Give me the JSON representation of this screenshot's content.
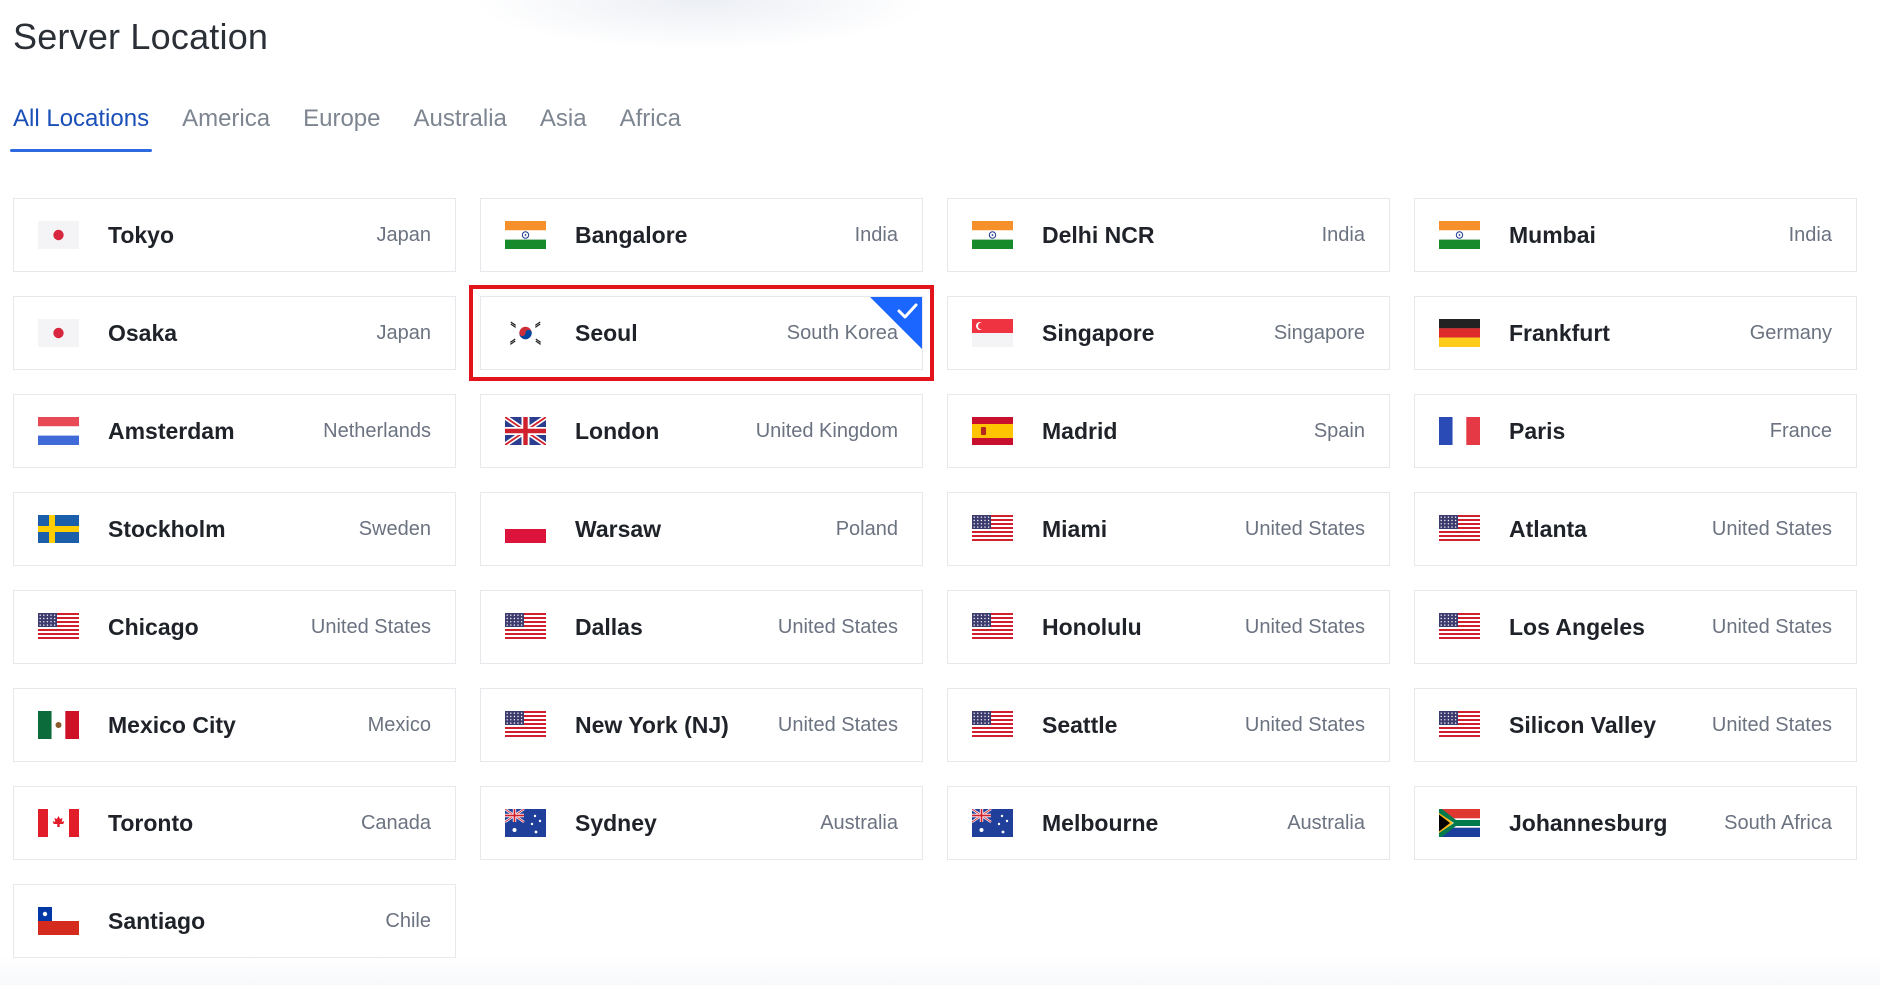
{
  "page": {
    "title": "Server Location"
  },
  "tabs": [
    {
      "label": "All Locations",
      "active": true
    },
    {
      "label": "America",
      "active": false
    },
    {
      "label": "Europe",
      "active": false
    },
    {
      "label": "Australia",
      "active": false
    },
    {
      "label": "Asia",
      "active": false
    },
    {
      "label": "Africa",
      "active": false
    }
  ],
  "selected_location": "Seoul",
  "colors": {
    "accent": "#2d6ae0",
    "selection_outline": "#e3131b",
    "check_badge": "#1a66ff"
  },
  "locations": [
    {
      "city": "Tokyo",
      "country": "Japan",
      "flag": "jp-flag-icon"
    },
    {
      "city": "Bangalore",
      "country": "India",
      "flag": "in-flag-icon"
    },
    {
      "city": "Delhi NCR",
      "country": "India",
      "flag": "in-flag-icon"
    },
    {
      "city": "Mumbai",
      "country": "India",
      "flag": "in-flag-icon"
    },
    {
      "city": "Osaka",
      "country": "Japan",
      "flag": "jp-flag-icon"
    },
    {
      "city": "Seoul",
      "country": "South Korea",
      "flag": "kr-flag-icon"
    },
    {
      "city": "Singapore",
      "country": "Singapore",
      "flag": "sg-flag-icon"
    },
    {
      "city": "Frankfurt",
      "country": "Germany",
      "flag": "de-flag-icon"
    },
    {
      "city": "Amsterdam",
      "country": "Netherlands",
      "flag": "nl-flag-icon"
    },
    {
      "city": "London",
      "country": "United Kingdom",
      "flag": "gb-flag-icon"
    },
    {
      "city": "Madrid",
      "country": "Spain",
      "flag": "es-flag-icon"
    },
    {
      "city": "Paris",
      "country": "France",
      "flag": "fr-flag-icon"
    },
    {
      "city": "Stockholm",
      "country": "Sweden",
      "flag": "se-flag-icon"
    },
    {
      "city": "Warsaw",
      "country": "Poland",
      "flag": "pl-flag-icon"
    },
    {
      "city": "Miami",
      "country": "United States",
      "flag": "us-flag-icon"
    },
    {
      "city": "Atlanta",
      "country": "United States",
      "flag": "us-flag-icon"
    },
    {
      "city": "Chicago",
      "country": "United States",
      "flag": "us-flag-icon"
    },
    {
      "city": "Dallas",
      "country": "United States",
      "flag": "us-flag-icon"
    },
    {
      "city": "Honolulu",
      "country": "United States",
      "flag": "us-flag-icon"
    },
    {
      "city": "Los Angeles",
      "country": "United States",
      "flag": "us-flag-icon"
    },
    {
      "city": "Mexico City",
      "country": "Mexico",
      "flag": "mx-flag-icon"
    },
    {
      "city": "New York (NJ)",
      "country": "United States",
      "flag": "us-flag-icon"
    },
    {
      "city": "Seattle",
      "country": "United States",
      "flag": "us-flag-icon"
    },
    {
      "city": "Silicon Valley",
      "country": "United States",
      "flag": "us-flag-icon"
    },
    {
      "city": "Toronto",
      "country": "Canada",
      "flag": "ca-flag-icon"
    },
    {
      "city": "Sydney",
      "country": "Australia",
      "flag": "au-flag-icon"
    },
    {
      "city": "Melbourne",
      "country": "Australia",
      "flag": "au-flag-icon"
    },
    {
      "city": "Johannesburg",
      "country": "South Africa",
      "flag": "za-flag-icon"
    },
    {
      "city": "Santiago",
      "country": "Chile",
      "flag": "cl-flag-icon"
    }
  ]
}
